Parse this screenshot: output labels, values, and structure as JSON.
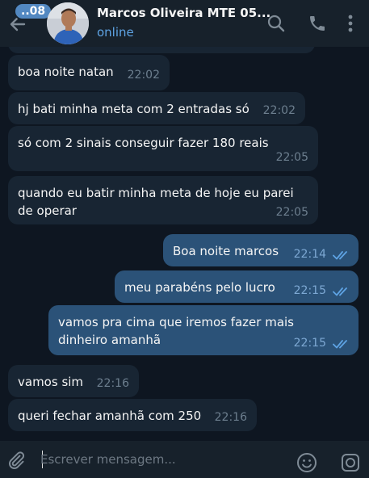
{
  "header": {
    "unread_count": "..08",
    "contact_name": "Marcos Oliveira MTE 05...",
    "status": "online"
  },
  "messages": [
    {
      "direction": "in",
      "text": "boa noite natan",
      "time": "22:02"
    },
    {
      "direction": "in",
      "text": "hj bati minha meta com 2 entradas só",
      "time": "22:02"
    },
    {
      "direction": "in",
      "text": "só  com 2 sinais conseguir fazer 180 reais",
      "time": "22:05"
    },
    {
      "direction": "in",
      "text": "quando eu batir minha meta de hoje eu parei de operar",
      "time": "22:05"
    },
    {
      "direction": "out",
      "text": "Boa noite marcos",
      "time": "22:14",
      "read": true
    },
    {
      "direction": "out",
      "text": "meu parabéns  pelo lucro",
      "time": "22:15",
      "read": true
    },
    {
      "direction": "out",
      "text": "vamos pra cima que iremos fazer mais dinheiro amanhã",
      "time": "22:15",
      "read": true
    },
    {
      "direction": "in",
      "text": "vamos sim",
      "time": "22:16"
    },
    {
      "direction": "in",
      "text": "queri fechar amanhã com 250",
      "time": "22:16"
    }
  ],
  "composer": {
    "placeholder": "Escrever mensagem..."
  },
  "colors": {
    "background": "#0e1621",
    "header": "#17212b",
    "incoming_bubble": "#182533",
    "outgoing_bubble": "#2b5278",
    "accent": "#5ea3e4"
  },
  "icons": [
    "back-arrow-icon",
    "search-icon",
    "phone-icon",
    "more-vertical-icon",
    "attach-icon",
    "emoji-icon",
    "camera-icon",
    "double-check-icon"
  ]
}
